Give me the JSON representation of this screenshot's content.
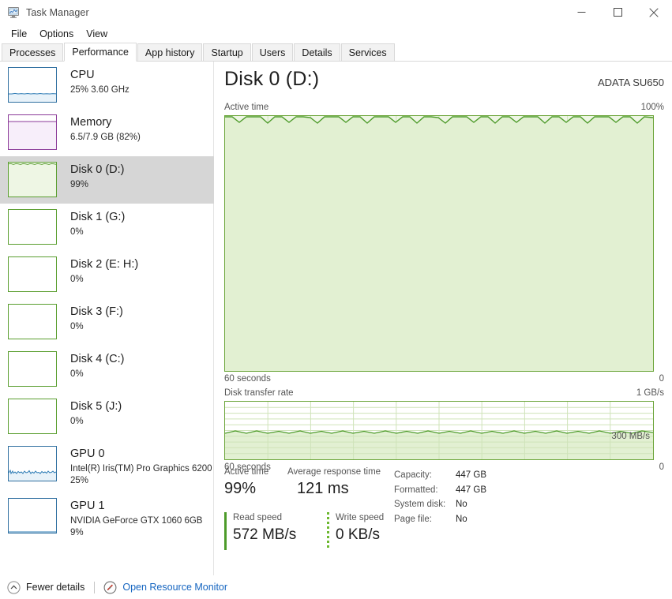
{
  "window": {
    "title": "Task Manager",
    "icon": "task-manager-icon",
    "buttons": {
      "minimize": "minimize-icon",
      "maximize": "maximize-icon",
      "close": "close-icon"
    }
  },
  "menu": {
    "items": [
      "File",
      "Options",
      "View"
    ]
  },
  "tabs": {
    "items": [
      "Processes",
      "Performance",
      "App history",
      "Startup",
      "Users",
      "Details",
      "Services"
    ],
    "active": "Performance"
  },
  "sidebar": {
    "items": [
      {
        "name": "CPU",
        "sub": "25%  3.60 GHz",
        "sub2": "",
        "accent": "#2f6fa0",
        "kind": "cpu"
      },
      {
        "name": "Memory",
        "sub": "6.5/7.9 GB (82%)",
        "sub2": "",
        "accent": "#8b3a98",
        "kind": "memory"
      },
      {
        "name": "Disk 0 (D:)",
        "sub": "99%",
        "sub2": "",
        "accent": "#5a9e2f",
        "kind": "disk-active",
        "selected": true
      },
      {
        "name": "Disk 1 (G:)",
        "sub": "0%",
        "sub2": "",
        "accent": "#5a9e2f",
        "kind": "disk-idle"
      },
      {
        "name": "Disk 2 (E: H:)",
        "sub": "0%",
        "sub2": "",
        "accent": "#5a9e2f",
        "kind": "disk-idle"
      },
      {
        "name": "Disk 3 (F:)",
        "sub": "0%",
        "sub2": "",
        "accent": "#5a9e2f",
        "kind": "disk-idle"
      },
      {
        "name": "Disk 4 (C:)",
        "sub": "0%",
        "sub2": "",
        "accent": "#5a9e2f",
        "kind": "disk-idle"
      },
      {
        "name": "Disk 5 (J:)",
        "sub": "0%",
        "sub2": "",
        "accent": "#5a9e2f",
        "kind": "disk-idle"
      },
      {
        "name": "GPU 0",
        "sub": "Intel(R) Iris(TM) Pro Graphics 6200",
        "sub2": "25%",
        "accent": "#2f6fa0",
        "kind": "gpu-active"
      },
      {
        "name": "GPU 1",
        "sub": "NVIDIA GeForce GTX 1060 6GB",
        "sub2": "9%",
        "accent": "#2f6fa0",
        "kind": "gpu-idle"
      }
    ]
  },
  "statusbar": {
    "fewer_details": "Fewer details",
    "resource_monitor": "Open Resource Monitor",
    "fewer_icon": "chevron-up-circle-icon",
    "monitor_icon": "resource-monitor-icon"
  },
  "main": {
    "title": "Disk 0 (D:)",
    "model": "ADATA SU650",
    "active_chart": {
      "label": "Active time",
      "max_label": "100%",
      "min_label": "0",
      "time_label": "60 seconds"
    },
    "transfer_chart": {
      "label": "Disk transfer rate",
      "max_label": "1 GB/s",
      "min_label": "0",
      "time_label": "60 seconds",
      "inline_label": "300 MB/s"
    },
    "stats": {
      "active_time_label": "Active time",
      "active_time_value": "99%",
      "avg_response_label": "Average response time",
      "avg_response_value": "121 ms",
      "read_label": "Read speed",
      "read_value": "572 MB/s",
      "write_label": "Write speed",
      "write_value": "0 KB/s",
      "info": [
        {
          "key": "Capacity:",
          "value": "447 GB"
        },
        {
          "key": "Formatted:",
          "value": "447 GB"
        },
        {
          "key": "System disk:",
          "value": "No"
        },
        {
          "key": "Page file:",
          "value": "No"
        }
      ]
    }
  },
  "chart_data": {
    "type": "area",
    "charts": [
      {
        "name": "Active time",
        "ylabel": "Active time",
        "ylim": [
          0,
          100
        ],
        "ymax_label": "100%",
        "ymin_label": "0",
        "xlabel": "60 seconds",
        "grid": true,
        "color": "#6ba539",
        "fill": "#eef6e4",
        "values": [
          100,
          100,
          99,
          100,
          98,
          97,
          98,
          100,
          100,
          99,
          97,
          98,
          100,
          100,
          99,
          97,
          98,
          100,
          100,
          100,
          98,
          97,
          98,
          100,
          100,
          99,
          98,
          97,
          99,
          100,
          100,
          98,
          97,
          98,
          100,
          100,
          99,
          97,
          98,
          100,
          100,
          100,
          98,
          97,
          98,
          100,
          100,
          99,
          98,
          97,
          98,
          100,
          100,
          99,
          97,
          98,
          100,
          100,
          99,
          98
        ]
      },
      {
        "name": "Disk transfer rate",
        "ylabel": "Disk transfer rate",
        "ylim": [
          0,
          1000
        ],
        "ymax_label": "1 GB/s",
        "ymin_label": "0",
        "xlabel": "60 seconds",
        "inline_label": "300 MB/s",
        "grid": true,
        "color": "#6ba539",
        "fill": "#eef6e4",
        "values": [
          560,
          575,
          565,
          580,
          560,
          570,
          585,
          565,
          575,
          560,
          580,
          565,
          570,
          585,
          560,
          575,
          565,
          580,
          560,
          570,
          585,
          565,
          575,
          560,
          580,
          565,
          570,
          585,
          560,
          575,
          565,
          580,
          560,
          570,
          585,
          565,
          575,
          560,
          580,
          565,
          570,
          585,
          560,
          575,
          565,
          580,
          560,
          570,
          585,
          565,
          575,
          560,
          580,
          565,
          570,
          585,
          560,
          575,
          565,
          580
        ]
      }
    ]
  },
  "colors": {
    "disk_accent": "#6ba539",
    "cpu_accent": "#2f6fa0",
    "memory_accent": "#8b3a98",
    "link": "#1565c0",
    "selected_row": "#d6d6d6"
  }
}
